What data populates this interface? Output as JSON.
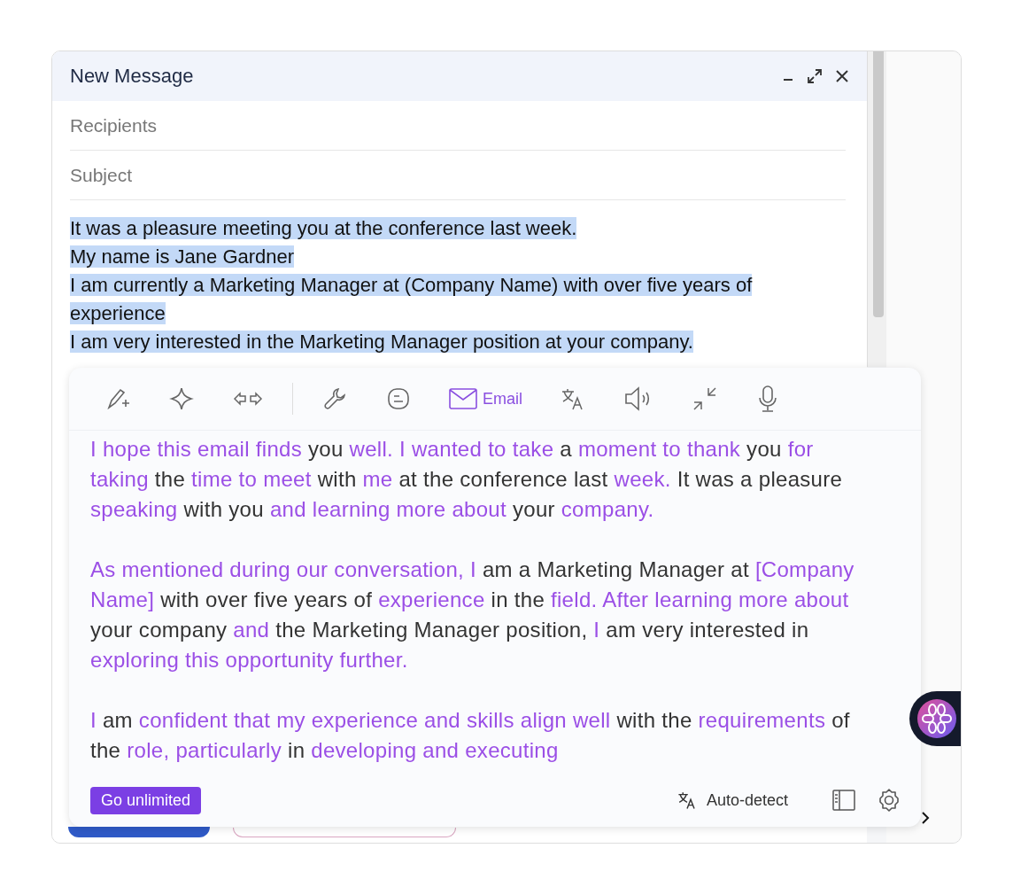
{
  "window": {
    "title": "New Message"
  },
  "fields": [
    {
      "placeholder": "Recipients"
    },
    {
      "placeholder": "Subject"
    }
  ],
  "body": {
    "lines": [
      {
        "text": "It was a pleasure meeting you at the conference last week.",
        "selected": true
      },
      {
        "text": "My name is Jane Gardner",
        "selected": true
      },
      {
        "text": "I am currently a Marketing Manager at (Company Name) with over five years of",
        "selected": true
      },
      {
        "text": "experience",
        "selected": true
      },
      {
        "text": "I am very interested in the Marketing Manager position at your company.",
        "selected": true
      }
    ]
  },
  "assistant": {
    "tools": [
      {
        "kind": "rewrite",
        "selected": false
      },
      {
        "kind": "sparkle",
        "selected": false
      },
      {
        "kind": "arrows",
        "selected": false
      },
      {
        "kind": "divider"
      },
      {
        "kind": "wrench",
        "selected": false
      },
      {
        "kind": "chat",
        "selected": false
      },
      {
        "kind": "email",
        "label": "Email",
        "selected": true
      },
      {
        "kind": "translate",
        "selected": false
      },
      {
        "kind": "speaker",
        "selected": false
      },
      {
        "kind": "shrink",
        "selected": false
      },
      {
        "kind": "mic",
        "selected": false
      }
    ],
    "paragraphs": [
      [
        {
          "text": "I hope this email finds",
          "changed": true
        },
        {
          "text": " you ",
          "changed": false
        },
        {
          "text": "well. I wanted to take",
          "changed": true
        },
        {
          "text": " a ",
          "changed": false
        },
        {
          "text": "moment to thank",
          "changed": true
        },
        {
          "text": " you ",
          "changed": false
        },
        {
          "text": "for taking",
          "changed": true
        },
        {
          "text": " the ",
          "changed": false
        },
        {
          "text": "time to meet",
          "changed": true
        },
        {
          "text": " with ",
          "changed": false
        },
        {
          "text": "me",
          "changed": true
        },
        {
          "text": " at the conference last ",
          "changed": false
        },
        {
          "text": "week.",
          "changed": true
        },
        {
          "text": " It was a pleasure ",
          "changed": false
        },
        {
          "text": "speaking",
          "changed": true
        },
        {
          "text": " with you ",
          "changed": false
        },
        {
          "text": "and learning more about",
          "changed": true
        },
        {
          "text": " your ",
          "changed": false
        },
        {
          "text": "company.",
          "changed": true
        }
      ],
      [
        {
          "text": "As mentioned during our conversation, I",
          "changed": true
        },
        {
          "text": " am a Marketing Manager at ",
          "changed": false
        },
        {
          "text": "[Company Name]",
          "changed": true
        },
        {
          "text": " with over five years of ",
          "changed": false
        },
        {
          "text": "experience",
          "changed": true
        },
        {
          "text": " in the ",
          "changed": false
        },
        {
          "text": "field. After learning more about",
          "changed": true
        },
        {
          "text": " your company ",
          "changed": false
        },
        {
          "text": "and",
          "changed": true
        },
        {
          "text": " the Marketing Manager position, ",
          "changed": false
        },
        {
          "text": "I",
          "changed": true
        },
        {
          "text": " am very interested in ",
          "changed": false
        },
        {
          "text": "exploring this opportunity further.",
          "changed": true
        }
      ],
      [
        {
          "text": "I",
          "changed": true
        },
        {
          "text": " am ",
          "changed": false
        },
        {
          "text": "confident that my experience and skills align well",
          "changed": true
        },
        {
          "text": " with the ",
          "changed": false
        },
        {
          "text": "requirements",
          "changed": true
        },
        {
          "text": " of the ",
          "changed": false
        },
        {
          "text": "role, particularly",
          "changed": true
        },
        {
          "text": " in ",
          "changed": false
        },
        {
          "text": "developing and executing",
          "changed": true
        }
      ]
    ],
    "upgrade_button": "Go unlimited",
    "language": "Auto-detect"
  }
}
